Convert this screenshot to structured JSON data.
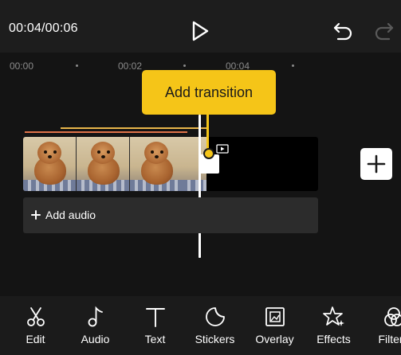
{
  "player": {
    "timecode": "00:04/00:06"
  },
  "ruler": {
    "labels": [
      "00:00",
      "00:02",
      "00:04"
    ]
  },
  "tooltip": {
    "text": "Add transition"
  },
  "audio": {
    "add_label": "Add audio"
  },
  "toolbar": {
    "items": [
      {
        "label": "Edit",
        "icon": "scissors-icon"
      },
      {
        "label": "Audio",
        "icon": "music-note-icon"
      },
      {
        "label": "Text",
        "icon": "text-icon"
      },
      {
        "label": "Stickers",
        "icon": "sticker-icon"
      },
      {
        "label": "Overlay",
        "icon": "overlay-icon"
      },
      {
        "label": "Effects",
        "icon": "star-icon"
      },
      {
        "label": "Filters",
        "icon": "filter-icon"
      }
    ]
  },
  "colors": {
    "accent": "#f5c518",
    "background": "#141414"
  }
}
